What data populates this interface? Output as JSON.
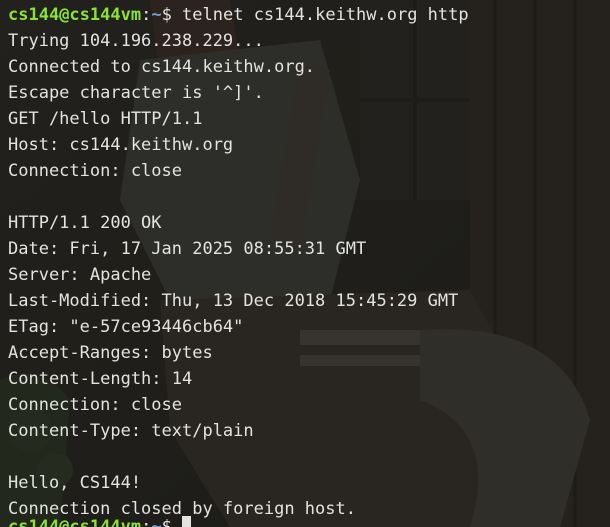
{
  "terminal": {
    "prompt": {
      "user_host": "cs144@cs144vm",
      "separator": ":",
      "path": "~",
      "symbol": "$ ",
      "command": "telnet cs144.keithw.org http"
    },
    "lines": [
      "Trying 104.196.238.229...",
      "Connected to cs144.keithw.org.",
      "Escape character is '^]'.",
      "GET /hello HTTP/1.1",
      "Host: cs144.keithw.org",
      "Connection: close",
      "",
      "HTTP/1.1 200 OK",
      "Date: Fri, 17 Jan 2025 08:55:31 GMT",
      "Server: Apache",
      "Last-Modified: Thu, 13 Dec 2018 15:45:29 GMT",
      "ETag: \"e-57ce93446cb64\"",
      "Accept-Ranges: bytes",
      "Content-Length: 14",
      "Connection: close",
      "Content-Type: text/plain",
      "",
      "Hello, CS144!",
      "Connection closed by foreign host."
    ]
  },
  "colors": {
    "prompt_user": "#8ae234",
    "prompt_path": "#729fcf",
    "text": "#e3e3df",
    "background": "#1f2220"
  },
  "icons": {
    "cursor": "block-cursor"
  }
}
